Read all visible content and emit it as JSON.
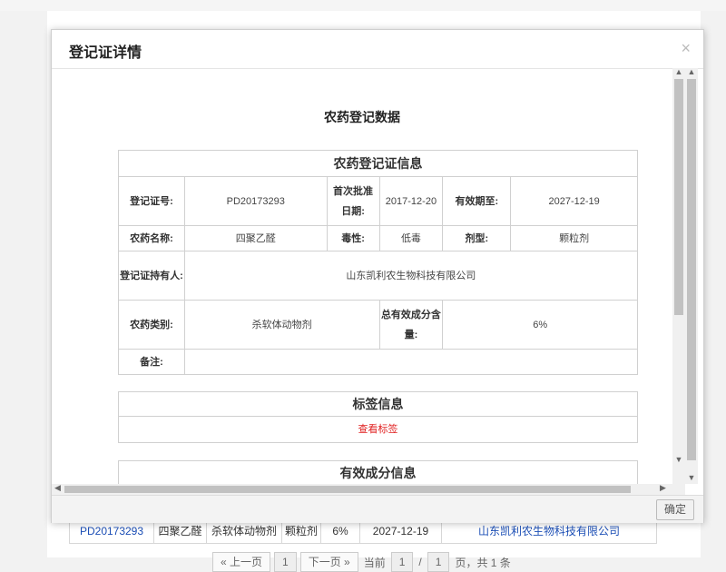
{
  "background": {
    "row": {
      "reg_no": "PD20173293",
      "name": "四聚乙醛",
      "category": "杀软体动物剂",
      "formulation": "颗粒剂",
      "content": "6%",
      "expiry": "2027-12-19",
      "holder": "山东凯利农生物科技有限公司"
    },
    "pager": {
      "prev": "« 上一页",
      "current_page": "1",
      "next": "下一页 »",
      "current_label": "当前",
      "page_input": "1",
      "slash": "/",
      "total_pages": "1",
      "summary": "页，共 1 条"
    }
  },
  "modal": {
    "title": "登记证详情",
    "close": "×",
    "ok": "确定",
    "doc_title": "农药登记数据",
    "cert": {
      "heading": "农药登记证信息",
      "reg_no_label": "登记证号:",
      "reg_no": "PD20173293",
      "first_date_label": "首次批准日期:",
      "first_date": "2017-12-20",
      "expiry_label": "有效期至:",
      "expiry": "2027-12-19",
      "name_label": "农药名称:",
      "name": "四聚乙醛",
      "toxicity_label": "毒性:",
      "toxicity": "低毒",
      "formulation_label": "剂型:",
      "formulation": "颗粒剂",
      "holder_label": "登记证持有人:",
      "holder": "山东凯利农生物科技有限公司",
      "category_label": "农药类别:",
      "category": "杀软体动物剂",
      "content_label": "总有效成分含量:",
      "content": "6%",
      "remark_label": "备注:",
      "remark": ""
    },
    "label_section": {
      "heading": "标签信息",
      "view_link": "查看标签"
    },
    "ingredient_section": {
      "heading": "有效成分信息"
    }
  },
  "colors": {
    "link_blue": "#1c4fb6",
    "link_red": "#e02020"
  }
}
